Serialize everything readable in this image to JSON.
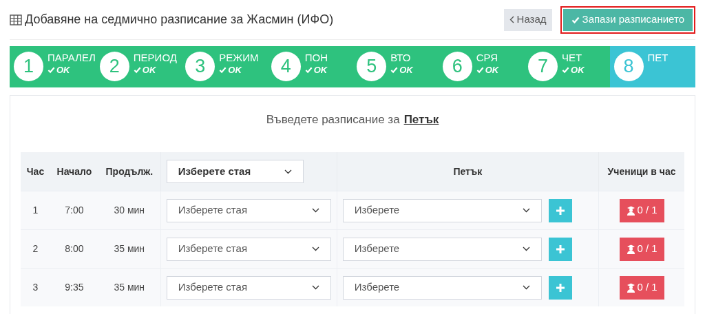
{
  "page": {
    "title": "Добавяне на седмично разписание за Жасмин (ИФО)"
  },
  "buttons": [
    {
      "kind": "back",
      "label": "Назад",
      "highlighted": false
    },
    {
      "kind": "save",
      "label": "Запази разписанието",
      "highlighted": true
    }
  ],
  "steps": [
    {
      "number": "1",
      "label": "ПАРАЛЕЛ",
      "status": "OK",
      "selected": false
    },
    {
      "number": "2",
      "label": "ПЕРИОД",
      "status": "OK",
      "selected": false
    },
    {
      "number": "3",
      "label": "РЕЖИМ",
      "status": "OK",
      "selected": false
    },
    {
      "number": "4",
      "label": "ПОН",
      "status": "OK",
      "selected": false
    },
    {
      "number": "5",
      "label": "ВТО",
      "status": "OK",
      "selected": false
    },
    {
      "number": "6",
      "label": "СРЯ",
      "status": "OK",
      "selected": false
    },
    {
      "number": "7",
      "label": "ЧЕТ",
      "status": "OK",
      "selected": false
    },
    {
      "number": "8",
      "label": "ПЕТ",
      "selected": true
    }
  ],
  "prompt": {
    "text": "Въведете разписание за",
    "day": "Петък"
  },
  "table": {
    "columns": [
      "Час",
      "Начало",
      "Продълж.",
      "Петък",
      "Ученици в час"
    ],
    "room_filter": "Изберете стая",
    "rows": [
      {
        "hour": "1",
        "start": "7:00",
        "duration": "30 мин",
        "room": "Изберете стая",
        "subject": "Изберете",
        "students": "0 / 1"
      },
      {
        "hour": "2",
        "start": "8:00",
        "duration": "35 мин",
        "room": "Изберете стая",
        "subject": "Изберете",
        "students": "0 / 1"
      },
      {
        "hour": "3",
        "start": "9:35",
        "duration": "35 мин",
        "room": "Изберете стая",
        "subject": "Изберете",
        "students": "0 / 1"
      }
    ]
  }
}
